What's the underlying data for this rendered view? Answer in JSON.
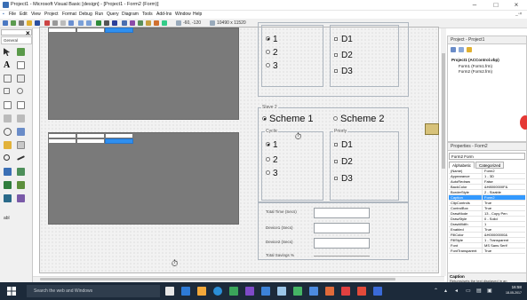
{
  "window": {
    "title": "Project1 - Microsoft Visual Basic [design] - [Project1 - Form2 (Form)]",
    "minimize": "–",
    "maximize": "□",
    "close": "×"
  },
  "menu": [
    "File",
    "Edit",
    "View",
    "Project",
    "Format",
    "Debug",
    "Run",
    "Query",
    "Diagram",
    "Tools",
    "Add-Ins",
    "Window",
    "Help"
  ],
  "toolbar": {
    "position_readout": "-60, -120",
    "size_readout": "10490 x 11520"
  },
  "toolbox": {
    "close_label": "×",
    "tab_label": "General",
    "misc_label": "abl"
  },
  "form": {
    "slave1_option_labels": [
      "1",
      "2",
      "3"
    ],
    "slave1_check_labels": [
      "D1",
      "D2",
      "D3"
    ],
    "slave2_title": "Slave 2",
    "slave2_schemes": [
      "Scheme 1",
      "Scheme 2"
    ],
    "cyclic_title": "Cyclic",
    "priority_title": "Priorly",
    "slave2_option_labels": [
      "1",
      "2",
      "3"
    ],
    "slave2_check_labels": [
      "D1",
      "D2",
      "D3"
    ],
    "stats_labels": [
      "Total Time (Secs)",
      "Device1 (Secs)",
      "Device2 (Secs)",
      "Total Savings %"
    ],
    "timer_glyph": "⏱"
  },
  "project_panel": {
    "title": "Project - Project1",
    "root": "Project1 (ACControl.vbp)",
    "forms": [
      "Form1 (Form1.frm)",
      "Form2 (Form2.frm)"
    ]
  },
  "properties_panel": {
    "title": "Properties - Form2",
    "object": "Form2 Form",
    "tabs": [
      "Alphabetic",
      "Categorized"
    ],
    "rows": [
      {
        "k": "(Name)",
        "v": "Form2"
      },
      {
        "k": "Appearance",
        "v": "1 - 3D"
      },
      {
        "k": "AutoRedraw",
        "v": "False"
      },
      {
        "k": "BackColor",
        "v": "&H8000000F&"
      },
      {
        "k": "BorderStyle",
        "v": "2 - Sizable"
      },
      {
        "k": "Caption",
        "v": "Form2"
      },
      {
        "k": "ClipControls",
        "v": "True"
      },
      {
        "k": "ControlBox",
        "v": "True"
      },
      {
        "k": "DrawMode",
        "v": "13 - Copy Pen"
      },
      {
        "k": "DrawStyle",
        "v": "0 - Solid"
      },
      {
        "k": "DrawWidth",
        "v": "1"
      },
      {
        "k": "Enabled",
        "v": "True"
      },
      {
        "k": "FillColor",
        "v": "&H00000000&"
      },
      {
        "k": "FillStyle",
        "v": "1 - Transparent"
      },
      {
        "k": "Font",
        "v": "MS Sans Serif"
      },
      {
        "k": "FontTransparent",
        "v": "True"
      }
    ],
    "selected_index": 5,
    "desc_title": "Caption",
    "desc_text": "Returns/sets the text displayed in an"
  },
  "taskbar": {
    "search_placeholder": "Search the web and Windows",
    "time": "16:58",
    "date": "18-05-2017"
  },
  "colors": {
    "selection": "#3399ff",
    "grid_selected": "#2f8fef",
    "taskbar": "#1c2a3a"
  }
}
